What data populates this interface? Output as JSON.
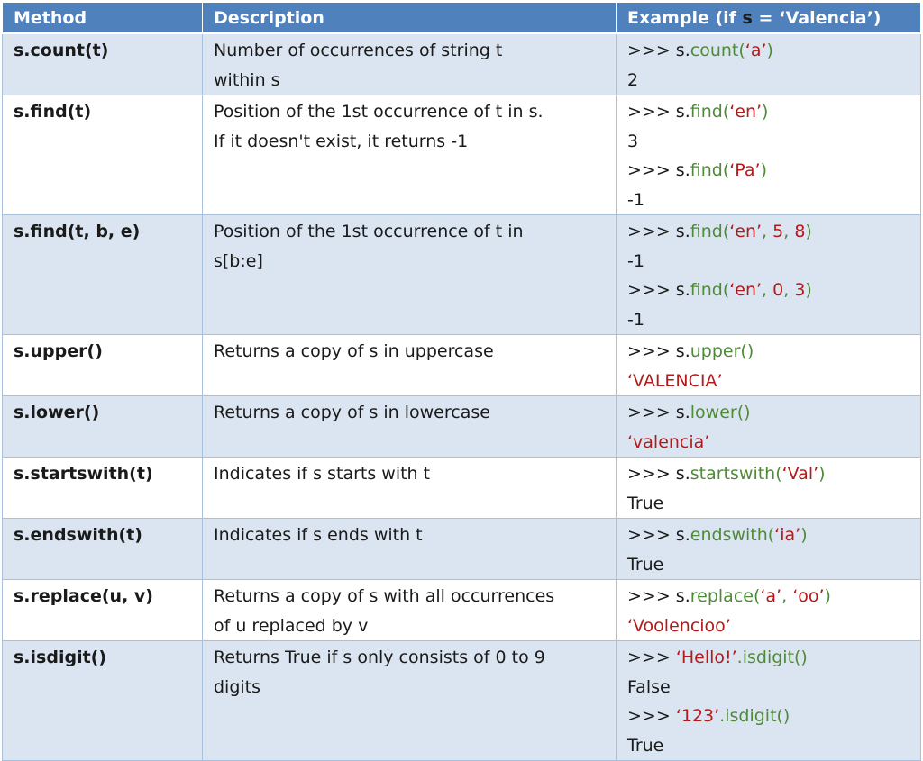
{
  "header": {
    "method": "Method",
    "description": "Description",
    "example_prefix": "Example (if ",
    "example_var": "s",
    "example_suffix": " = ‘Valencia’)"
  },
  "rows": [
    {
      "method": "s.count(t)",
      "description": [
        "Number of occurrences of string t",
        "within s"
      ],
      "example": [
        [
          {
            "t": ">>> s."
          },
          {
            "t": "count(",
            "c": "fn"
          },
          {
            "t": "‘a’",
            "c": "str"
          },
          {
            "t": ")",
            "c": "fn"
          }
        ],
        [
          {
            "t": "2"
          }
        ]
      ]
    },
    {
      "method": "s.find(t)",
      "description": [
        "Position of the 1st occurrence of t in s.",
        "If it doesn't exist, it returns -1"
      ],
      "example": [
        [
          {
            "t": ">>> s."
          },
          {
            "t": "find(",
            "c": "fn"
          },
          {
            "t": "‘en’",
            "c": "str"
          },
          {
            "t": ")",
            "c": "fn"
          }
        ],
        [
          {
            "t": "3"
          }
        ],
        [
          {
            "t": ">>> s."
          },
          {
            "t": "find(",
            "c": "fn"
          },
          {
            "t": "‘Pa’",
            "c": "str"
          },
          {
            "t": ")",
            "c": "fn"
          }
        ],
        [
          {
            "t": "-1"
          }
        ]
      ]
    },
    {
      "method": "s.find(t, b, e)",
      "description": [
        "Position of the 1st occurrence of t in",
        "s[b:e]"
      ],
      "example": [
        [
          {
            "t": ">>> s."
          },
          {
            "t": "find(",
            "c": "fn"
          },
          {
            "t": "‘en’",
            "c": "str"
          },
          {
            "t": ", ",
            "c": "fn"
          },
          {
            "t": "5",
            "c": "num"
          },
          {
            "t": ", ",
            "c": "fn"
          },
          {
            "t": "8",
            "c": "num"
          },
          {
            "t": ")",
            "c": "fn"
          }
        ],
        [
          {
            "t": "-1"
          }
        ],
        [
          {
            "t": ">>> s."
          },
          {
            "t": "find(",
            "c": "fn"
          },
          {
            "t": "‘en’",
            "c": "str"
          },
          {
            "t": ", ",
            "c": "fn"
          },
          {
            "t": "0",
            "c": "num"
          },
          {
            "t": ", ",
            "c": "fn"
          },
          {
            "t": "3",
            "c": "num"
          },
          {
            "t": ")",
            "c": "fn"
          }
        ],
        [
          {
            "t": "-1"
          }
        ]
      ]
    },
    {
      "method": "s.upper()",
      "description": [
        "Returns a copy of s in uppercase"
      ],
      "example": [
        [
          {
            "t": ">>> s."
          },
          {
            "t": "upper()",
            "c": "fn"
          }
        ],
        [
          {
            "t": "‘VALENCIA’",
            "c": "str"
          }
        ]
      ]
    },
    {
      "method": "s.lower()",
      "description": [
        "Returns a copy of s in lowercase"
      ],
      "example": [
        [
          {
            "t": ">>> s."
          },
          {
            "t": "lower()",
            "c": "fn"
          }
        ],
        [
          {
            "t": "‘valencia’",
            "c": "str"
          }
        ]
      ]
    },
    {
      "method": "s.startswith(t)",
      "description": [
        "Indicates if s starts with t"
      ],
      "example": [
        [
          {
            "t": ">>> s."
          },
          {
            "t": "startswith(",
            "c": "fn"
          },
          {
            "t": "‘Val’",
            "c": "str"
          },
          {
            "t": ")",
            "c": "fn"
          }
        ],
        [
          {
            "t": "True"
          }
        ]
      ]
    },
    {
      "method": "s.endswith(t)",
      "description": [
        "Indicates if s ends with t"
      ],
      "example": [
        [
          {
            "t": ">>> s."
          },
          {
            "t": "endswith(",
            "c": "fn"
          },
          {
            "t": "‘ia’",
            "c": "str"
          },
          {
            "t": ")",
            "c": "fn"
          }
        ],
        [
          {
            "t": "True"
          }
        ]
      ]
    },
    {
      "method": "s.replace(u, v)",
      "description": [
        "Returns a copy of s with all occurrences",
        "of u replaced by v"
      ],
      "example": [
        [
          {
            "t": ">>> s."
          },
          {
            "t": "replace(",
            "c": "fn"
          },
          {
            "t": "‘a’",
            "c": "str"
          },
          {
            "t": ", ",
            "c": "fn"
          },
          {
            "t": "‘oo’",
            "c": "str"
          },
          {
            "t": ")",
            "c": "fn"
          }
        ],
        [
          {
            "t": "‘Voolencioo’",
            "c": "str"
          }
        ]
      ]
    },
    {
      "method": "s.isdigit()",
      "description": [
        "Returns True if s only consists of 0 to 9",
        "digits"
      ],
      "example": [
        [
          {
            "t": ">>> "
          },
          {
            "t": "‘Hello!’",
            "c": "str"
          },
          {
            "t": ".isdigit()",
            "c": "fn"
          }
        ],
        [
          {
            "t": "False"
          }
        ],
        [
          {
            "t": ">>> "
          },
          {
            "t": "‘123’",
            "c": "str"
          },
          {
            "t": ".isdigit()",
            "c": "fn"
          }
        ],
        [
          {
            "t": "True"
          }
        ]
      ]
    }
  ],
  "colors": {
    "header_bg": "#4f81bd",
    "shaded_row_bg": "#dbe5f1",
    "function_green": "#4f8a39",
    "string_red": "#b31b1b"
  }
}
